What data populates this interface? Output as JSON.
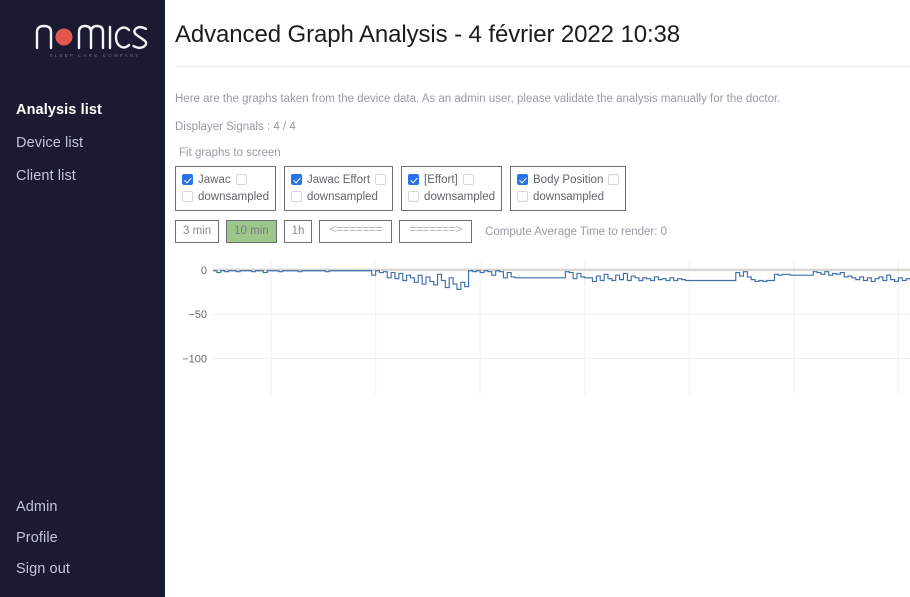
{
  "sidebar": {
    "logo": {
      "name": "nomics",
      "tagline": "SLEEP CARE COMPANY",
      "dot_color": "#e2584f"
    },
    "top_items": [
      {
        "label": "Analysis list",
        "active": true
      },
      {
        "label": "Device list",
        "active": false
      },
      {
        "label": "Client list",
        "active": false
      }
    ],
    "bottom_items": [
      {
        "label": "Admin"
      },
      {
        "label": "Profile"
      },
      {
        "label": "Sign out"
      }
    ],
    "background": "#1a1b30"
  },
  "header": {
    "title": "Advanced Graph Analysis - 4 février 2022 10:38"
  },
  "main": {
    "intro": "Here are the graphs taken from the device data. As an admin user, please validate the analysis manually for the doctor.",
    "signals_count": "Displayer Signals : 4 / 4",
    "fit_label": "Fit graphs to screen",
    "compute_text": "Compute Average Time to render: 0"
  },
  "signals": [
    {
      "label": "Jawac",
      "checked": true,
      "extra_checked": false,
      "downsampled_label": "downsampled",
      "downsampled_checked": false
    },
    {
      "label": "Jawac Effort",
      "checked": true,
      "extra_checked": false,
      "downsampled_label": "downsampled",
      "downsampled_checked": false
    },
    {
      "label": "[Effort]",
      "checked": true,
      "extra_checked": false,
      "downsampled_label": "downsampled",
      "downsampled_checked": false
    },
    {
      "label": "Body Position",
      "checked": true,
      "extra_checked": false,
      "downsampled_label": "downsampled",
      "downsampled_checked": false
    }
  ],
  "toolbar": {
    "buttons": [
      {
        "label": "3 min",
        "selected": false,
        "mono": false
      },
      {
        "label": "10 min",
        "selected": true,
        "mono": false
      },
      {
        "label": "1h",
        "selected": false,
        "mono": false
      },
      {
        "label": "<=======",
        "selected": false,
        "mono": true
      },
      {
        "label": "=======>",
        "selected": false,
        "mono": true
      }
    ],
    "selected_color": "#9cc68b"
  },
  "chart_data": {
    "type": "line",
    "title": "",
    "xlabel": "",
    "ylabel": "",
    "line_color": "#3d6fa8",
    "grid": true,
    "legend": "none",
    "ylim": [
      -140,
      10
    ],
    "yticks": [
      0,
      -50,
      -100
    ],
    "ytick_labels": [
      "0",
      "−50",
      "−100"
    ],
    "xlim": [
      0,
      720
    ],
    "xticks": [
      60,
      168,
      276,
      384,
      492,
      600,
      708
    ],
    "xtick_labels": [
      "",
      "",
      "",
      "",
      "",
      "",
      ""
    ],
    "series": [
      {
        "name": "Jawac",
        "x": [
          0,
          4,
          8,
          12,
          16,
          20,
          24,
          28,
          32,
          36,
          40,
          44,
          48,
          52,
          56,
          60,
          64,
          68,
          72,
          76,
          80,
          84,
          88,
          92,
          96,
          100,
          104,
          108,
          112,
          116,
          120,
          124,
          128,
          132,
          136,
          140,
          144,
          148,
          152,
          156,
          160,
          164,
          168,
          172,
          176,
          180,
          184,
          188,
          192,
          196,
          200,
          204,
          208,
          212,
          216,
          220,
          224,
          228,
          232,
          236,
          240,
          244,
          248,
          252,
          256,
          260,
          264,
          268,
          272,
          276,
          280,
          284,
          288,
          292,
          296,
          300,
          304,
          308,
          312,
          316,
          320,
          324,
          328,
          332,
          336,
          340,
          344,
          348,
          352,
          356,
          360,
          364,
          368,
          372,
          376,
          380,
          384,
          388,
          392,
          396,
          400,
          404,
          408,
          412,
          416,
          420,
          424,
          428,
          432,
          436,
          440,
          444,
          448,
          452,
          456,
          460,
          464,
          468,
          472,
          476,
          480,
          484,
          488,
          492,
          496,
          500,
          504,
          508,
          512,
          516,
          520,
          524,
          528,
          532,
          536,
          540,
          544,
          548,
          552,
          556,
          560,
          564,
          568,
          572,
          576,
          580,
          584,
          588,
          592,
          596,
          600,
          604,
          608,
          612,
          616,
          620,
          624,
          628,
          632,
          636,
          640,
          644,
          648,
          652,
          656,
          660,
          664,
          668,
          672,
          676,
          680,
          684,
          688,
          692,
          696,
          700,
          704,
          708,
          712,
          716,
          720
        ],
        "y": [
          -1,
          -3,
          -1,
          -2,
          -1,
          -1,
          -2,
          -1,
          -1,
          -1,
          -2,
          -1,
          -1,
          -3,
          -1,
          -1,
          -1,
          -2,
          -1,
          -1,
          -1,
          -1,
          -2,
          -1,
          -1,
          -1,
          -1,
          -1,
          -1,
          -2,
          -1,
          -1,
          -1,
          -1,
          -1,
          -1,
          -1,
          -1,
          -1,
          -1,
          -1,
          -6,
          -1,
          -3,
          -2,
          -9,
          -3,
          -10,
          -4,
          -12,
          -6,
          -9,
          -14,
          -6,
          -16,
          -8,
          -13,
          -17,
          -5,
          -12,
          -20,
          -9,
          -16,
          -22,
          -14,
          -19,
          -1,
          -2,
          -1,
          -3,
          -1,
          -2,
          -6,
          -1,
          -2,
          -9,
          -3,
          -8,
          -9,
          -9,
          -9,
          -9,
          -9,
          -9,
          -9,
          -9,
          -9,
          -9,
          -9,
          -9,
          -9,
          -2,
          -3,
          -10,
          -4,
          -8,
          -9,
          -9,
          -13,
          -7,
          -12,
          -5,
          -10,
          -12,
          -6,
          -11,
          -4,
          -12,
          -7,
          -9,
          -12,
          -9,
          -10,
          -12,
          -8,
          -11,
          -10,
          -12,
          -9,
          -12,
          -10,
          -11,
          -12,
          -12,
          -12,
          -12,
          -12,
          -12,
          -12,
          -12,
          -12,
          -12,
          -12,
          -12,
          -12,
          -3,
          -7,
          -2,
          -8,
          -11,
          -13,
          -12,
          -13,
          -12,
          -12,
          -5,
          -6,
          -5,
          -5,
          -6,
          -6,
          -6,
          -6,
          -6,
          -6,
          -2,
          -3,
          -5,
          -2,
          -6,
          -4,
          -5,
          -3,
          -8,
          -7,
          -9,
          -11,
          -8,
          -12,
          -9,
          -13,
          -10,
          -8,
          -12,
          -6,
          -11,
          -13,
          -9,
          -12,
          -10,
          -12,
          -9,
          -13,
          -11,
          -12,
          -10
        ]
      }
    ]
  }
}
